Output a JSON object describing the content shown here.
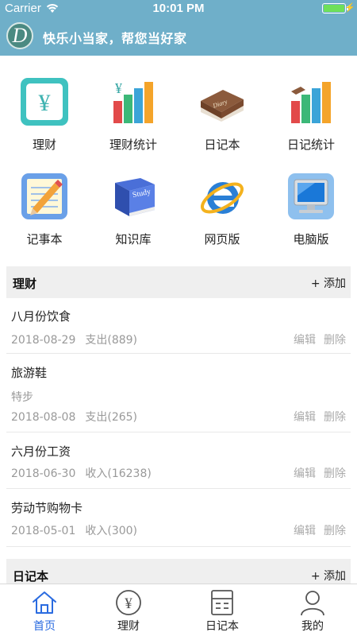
{
  "status_bar": {
    "carrier": "Carrier",
    "time": "10:01 PM"
  },
  "header": {
    "logo_letter": "D",
    "title": "快乐小当家，帮您当好家"
  },
  "grid": [
    {
      "label": "理财",
      "icon": "finance-icon"
    },
    {
      "label": "理财统计",
      "icon": "finance-stats-icon"
    },
    {
      "label": "日记本",
      "icon": "diary-book-icon"
    },
    {
      "label": "日记统计",
      "icon": "diary-stats-icon"
    },
    {
      "label": "记事本",
      "icon": "notepad-icon"
    },
    {
      "label": "知识库",
      "icon": "study-book-icon"
    },
    {
      "label": "网页版",
      "icon": "ie-browser-icon"
    },
    {
      "label": "电脑版",
      "icon": "computer-icon"
    }
  ],
  "icon_text": {
    "yuan": "¥",
    "diary": "Diary",
    "study": "Study"
  },
  "finance_section": {
    "title": "理财",
    "add": "+ 添加",
    "records": [
      {
        "title": "八月份饮食",
        "subtitle": "",
        "date": "2018-08-29",
        "amount": "支出(889)",
        "edit": "编辑",
        "delete": "删除"
      },
      {
        "title": "旅游鞋",
        "subtitle": "特步",
        "date": "2018-08-08",
        "amount": "支出(265)",
        "edit": "编辑",
        "delete": "删除"
      },
      {
        "title": "六月份工资",
        "subtitle": "",
        "date": "2018-06-30",
        "amount": "收入(16238)",
        "edit": "编辑",
        "delete": "删除"
      },
      {
        "title": "劳动节购物卡",
        "subtitle": "",
        "date": "2018-05-01",
        "amount": "收入(300)",
        "edit": "编辑",
        "delete": "删除"
      }
    ]
  },
  "diary_section": {
    "title": "日记本",
    "add": "+ 添加"
  },
  "tabbar": {
    "active_color": "#2a6be0",
    "tabs": [
      {
        "label": "首页",
        "icon": "home-icon",
        "active": true
      },
      {
        "label": "理财",
        "icon": "yuan-circle-icon",
        "active": false
      },
      {
        "label": "日记本",
        "icon": "notebook-icon",
        "active": false
      },
      {
        "label": "我的",
        "icon": "user-icon",
        "active": false
      }
    ]
  },
  "colors": {
    "header": "#6fafc9",
    "section_bg": "#efefef"
  }
}
